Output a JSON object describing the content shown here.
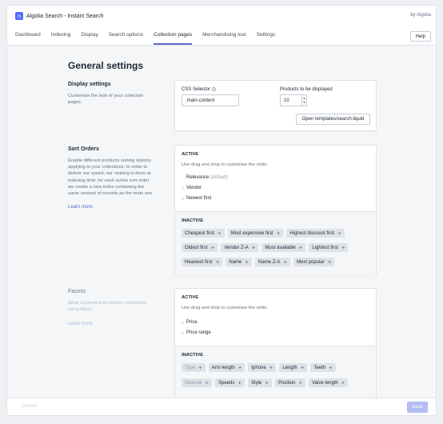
{
  "app": {
    "logo_glyph": "◷",
    "title": "Algolia Search - Instant Search",
    "by": "by Algolia"
  },
  "nav": {
    "tabs": [
      "Dashboard",
      "Indexing",
      "Display",
      "Search options",
      "Collection pages",
      "Merchandising tool",
      "Settings"
    ],
    "active_index": 4,
    "help_label": "Help"
  },
  "page": {
    "title": "General settings"
  },
  "display_settings": {
    "title": "Display settings",
    "description": "Customise the look of your collection pages.",
    "css_selector_label": "CSS Selector",
    "css_selector_value": ".main-content",
    "products_label": "Products to be displayed",
    "products_value": "10",
    "open_button": "Open templates/search.liquid"
  },
  "sort_orders": {
    "title": "Sort Orders",
    "description": "Enable different products sorting options applying to your collections. In order to deliver our speed, our ranking is done at indexing time: for each active sort order we create a new index containing the same amount of records as the main one.",
    "learn_more": "Learn more",
    "active_title": "ACTIVE",
    "hint": "Use drag and drop to customise the order.",
    "active_items": [
      {
        "label": "Relevance",
        "suffix": "(default)"
      },
      {
        "label": "Vendor"
      },
      {
        "label": "Newest first"
      }
    ],
    "inactive_title": "INACTIVE",
    "inactive_rows": [
      [
        "Cheapest first",
        "Most expensive first",
        "Highest discount first"
      ],
      [
        "Oldest first",
        "Vendor Z-A",
        "Most available",
        "Lightest first"
      ],
      [
        "Heaviest first",
        "Name",
        "Name Z-A",
        "Most popular"
      ]
    ]
  },
  "facets": {
    "title": "Facets",
    "description": "Allow customers to explore collections using filters.",
    "learn_more": "Learn more",
    "active_title": "ACTIVE",
    "hint": "Use drag and drop to customise the order.",
    "active_items": [
      "Price",
      "Price range"
    ],
    "inactive_title": "INACTIVE",
    "inactive_rows": [
      [
        "Type",
        "Arm length",
        "Iphone",
        "Length",
        "Teeth"
      ],
      [
        "Material",
        "Speeds",
        "Style",
        "Position",
        "Valve length"
      ]
    ]
  },
  "footer": {
    "text": "Cancel",
    "save": "Save"
  },
  "colors": {
    "accent": "#5c6ac4",
    "brand": "#5468ff",
    "save_disabled": "#b3bcf5"
  }
}
